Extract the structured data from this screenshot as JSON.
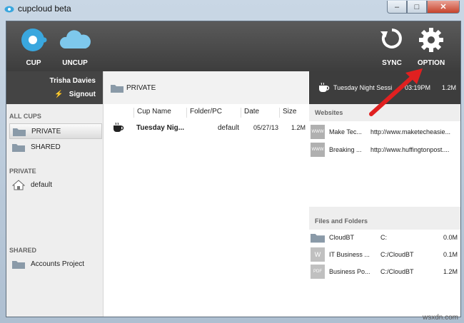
{
  "window": {
    "title": "cupcloud beta",
    "controls": {
      "minimize": "–",
      "maximize": "□",
      "close": "✕"
    }
  },
  "toolbar": {
    "cup_label": "CUP",
    "uncup_label": "UNCUP",
    "sync_label": "SYNC",
    "option_label": "OPTION"
  },
  "user": {
    "name": "Trisha Davies",
    "signout": "Signout"
  },
  "sidebar": {
    "all_cups_heading": "ALL CUPS",
    "all_cups": [
      {
        "label": "PRIVATE",
        "selected": true
      },
      {
        "label": "SHARED",
        "selected": false
      }
    ],
    "private_heading": "PRIVATE",
    "private_items": [
      {
        "label": "default"
      }
    ],
    "shared_heading": "SHARED",
    "shared_items": [
      {
        "label": "Accounts Project"
      }
    ]
  },
  "breadcrumb": {
    "label": "PRIVATE"
  },
  "table": {
    "columns": [
      "Cup Name",
      "Folder/PC",
      "Date",
      "Size"
    ],
    "rows": [
      {
        "name": "Tuesday Nig...",
        "folder": "default",
        "date": "05/27/13",
        "size": "1.2M"
      }
    ]
  },
  "now": {
    "name": "Tuesday Night Sessi",
    "time": "03:19PM",
    "size": "1.2M"
  },
  "websites": {
    "heading": "Websites",
    "items": [
      {
        "name": "Make Tec...",
        "url": "http://www.maketecheasie...",
        "icon_text": "WWW"
      },
      {
        "name": "Breaking ...",
        "url": "http://www.huffingtonpost....",
        "icon_text": "WWW"
      }
    ]
  },
  "files": {
    "heading": "Files and Folders",
    "items": [
      {
        "name": "CloudBT",
        "path": "C:",
        "size": "0.0M",
        "icon": "folder-icon"
      },
      {
        "name": "IT Business ...",
        "path": "C:/CloudBT",
        "size": "0.1M",
        "icon": "word-doc-icon",
        "icon_text": "W"
      },
      {
        "name": "Business Po...",
        "path": "C:/CloudBT",
        "size": "1.2M",
        "icon": "pdf-icon",
        "icon_text": "PDF"
      }
    ]
  },
  "watermark": "wsxdn.com",
  "colors": {
    "accent_blue": "#3aa7de",
    "toolbar_dark": "#444444",
    "arrow_red": "#e02020"
  }
}
